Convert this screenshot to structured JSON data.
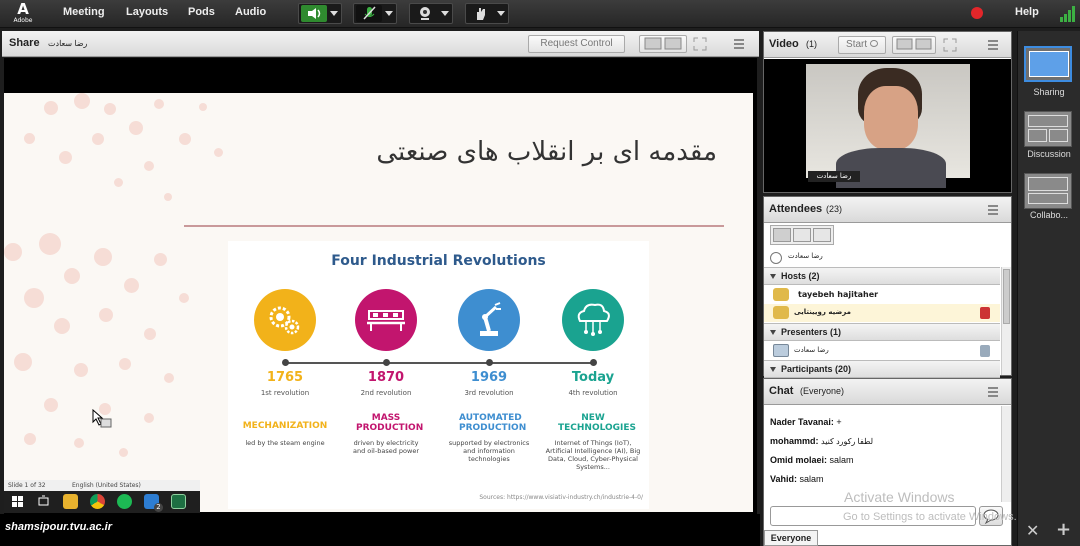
{
  "app": {
    "logo_text": "Adobe",
    "menu": [
      "Meeting",
      "Layouts",
      "Pods",
      "Audio"
    ],
    "help_label": "Help",
    "record_color": "#e3262a"
  },
  "toolbar_icons": [
    "speaker-icon",
    "microphone-muted-icon",
    "webcam-icon",
    "raise-hand-icon"
  ],
  "share_pod": {
    "title": "Share",
    "presenter": "رضا سعادت",
    "request_control": "Request Control"
  },
  "slide": {
    "title": "مقدمه ای بر انقلاب های صنعتی",
    "infographic_title": "Four Industrial Revolutions",
    "source": "Sources: https://www.visiativ-industry.ch/industrie-4-0/",
    "revolutions": [
      {
        "year": "1765",
        "ord": "1st revolution",
        "title": "MECHANIZATION",
        "desc": "led by the steam engine",
        "color": "#f2b21a",
        "icon": "gears-icon"
      },
      {
        "year": "1870",
        "ord": "2nd revolution",
        "title": "MASS PRODUCTION",
        "desc": "driven by electricity and oil-based power",
        "color": "#c2156e",
        "icon": "conveyor-icon"
      },
      {
        "year": "1969",
        "ord": "3rd revolution",
        "title": "AUTOMATED PRODUCTION",
        "desc": "supported by electronics and information technologies",
        "color": "#3e8ed0",
        "icon": "robot-arm-icon"
      },
      {
        "year": "Today",
        "ord": "4th revolution",
        "title": "NEW TECHNOLOGIES",
        "desc": "Internet of Things (IoT), Artificial Intelligence (AI), Big Data, Cloud, Cyber-Physical Systems...",
        "color": "#1aa390",
        "icon": "cloud-network-icon"
      }
    ]
  },
  "remote_desktop": {
    "status_slide": "Slide 1 of 32",
    "status_lang": "English (United States)",
    "taskbar_badge": "2"
  },
  "watermark": "shamsipour.tvu.ac.ir",
  "video_pod": {
    "title": "Video",
    "count": "(1)",
    "start_label": "Start",
    "name_tag": "رضا سعادت"
  },
  "attendees_pod": {
    "title": "Attendees",
    "count": "(23)",
    "me": "رضا سعادت",
    "hosts_label": "Hosts (2)",
    "hosts": [
      "tayebeh hajitaher",
      "مرضیه رویینتایی"
    ],
    "presenters_label": "Presenters (1)",
    "presenters": [
      "رضا سعادت"
    ],
    "participants_label": "Participants (20)"
  },
  "chat_pod": {
    "title": "Chat",
    "scope": "(Everyone)",
    "messages": [
      {
        "from": "Nader Tavanai:",
        "text": "+"
      },
      {
        "from": "mohammd:",
        "text": "لطفا رکورد کنید"
      },
      {
        "from": "Omid molaei:",
        "text": "salam"
      },
      {
        "from": "Vahid:",
        "text": "salam"
      }
    ],
    "input_placeholder": "",
    "recipient_tab": "Everyone"
  },
  "windows_activation": {
    "line1": "Activate Windows",
    "line2": "Go to Settings to activate Windows."
  },
  "layouts": [
    {
      "label": "Sharing"
    },
    {
      "label": "Discussion"
    },
    {
      "label": "Collabo..."
    }
  ]
}
